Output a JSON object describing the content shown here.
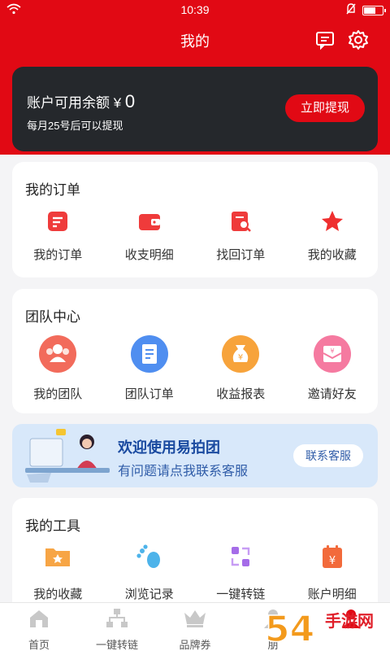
{
  "status_bar": {
    "time": "10:39"
  },
  "nav": {
    "title": "我的",
    "icons": [
      "message-icon",
      "gear-icon"
    ]
  },
  "balance": {
    "label": "账户可用余额 ¥",
    "amount": "0",
    "note": "每月25号后可以提现",
    "button": "立即提现"
  },
  "orders": {
    "title": "我的订单",
    "items": [
      {
        "label": "我的订单",
        "icon": "order-list-icon"
      },
      {
        "label": "收支明细",
        "icon": "wallet-icon"
      },
      {
        "label": "找回订单",
        "icon": "find-order-icon"
      },
      {
        "label": "我的收藏",
        "icon": "star-icon"
      }
    ]
  },
  "team": {
    "title": "团队中心",
    "items": [
      {
        "label": "我的团队",
        "icon": "team-icon"
      },
      {
        "label": "团队订单",
        "icon": "document-icon"
      },
      {
        "label": "收益报表",
        "icon": "money-bag-icon"
      },
      {
        "label": "邀请好友",
        "icon": "invite-envelope-icon"
      }
    ]
  },
  "banner": {
    "headline": "欢迎使用易拍团",
    "subline": "有问题请点我联系客服",
    "button": "联系客服"
  },
  "tools": {
    "title": "我的工具",
    "items": [
      {
        "label": "我的收藏",
        "icon": "folder-star-icon"
      },
      {
        "label": "浏览记录",
        "icon": "footprint-icon"
      },
      {
        "label": "一键转链",
        "icon": "convert-icon"
      },
      {
        "label": "账户明细",
        "icon": "calendar-yen-icon"
      }
    ]
  },
  "tabbar": [
    {
      "label": "首页",
      "icon": "home-icon"
    },
    {
      "label": "一键转链",
      "icon": "sitemap-icon"
    },
    {
      "label": "品牌券",
      "icon": "crown-icon"
    },
    {
      "label": "朋",
      "icon": "friends-icon"
    },
    {
      "label": "",
      "icon": "profile-icon"
    }
  ],
  "watermark": {
    "text": "手游网",
    "number": "54"
  },
  "colors": {
    "brand_red": "#e10914",
    "card_dark": "#25282c",
    "banner_blue": "#d8e8fa"
  }
}
